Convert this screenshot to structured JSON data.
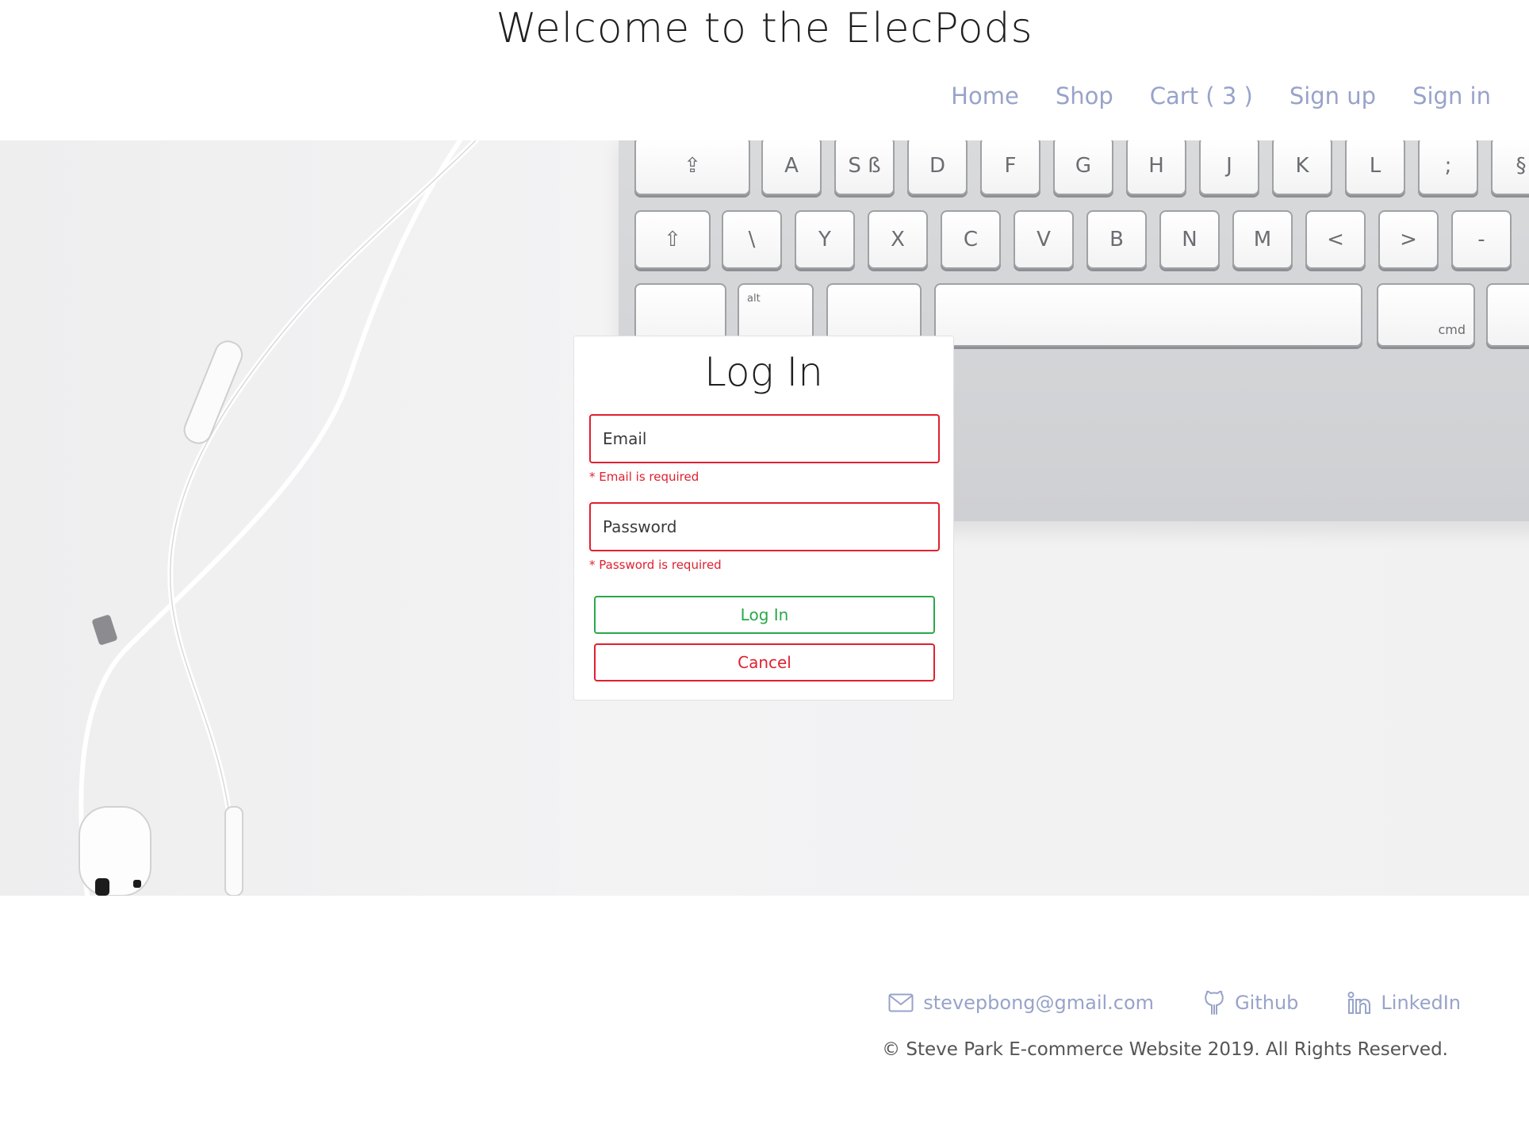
{
  "header": {
    "title": "Welcome to the ElecPods"
  },
  "nav": {
    "items": [
      {
        "label": "Home"
      },
      {
        "label": "Shop"
      },
      {
        "label": "Cart ( 3 )"
      },
      {
        "label": "Sign up"
      },
      {
        "label": "Sign in"
      }
    ]
  },
  "hero": {
    "keys_row1": [
      "A",
      "S ß",
      "D",
      "F",
      "G",
      "H",
      "J",
      "K",
      "L"
    ],
    "keys_row2": [
      "Y",
      "X",
      "C",
      "V",
      "B",
      "N",
      "M"
    ],
    "key_alt": "alt",
    "key_cmd": "cmd"
  },
  "login": {
    "title": "Log In",
    "email_placeholder": "Email",
    "email_error": "* Email is required",
    "password_placeholder": "Password",
    "password_error": "* Password is required",
    "submit_label": "Log In",
    "cancel_label": "Cancel"
  },
  "footer": {
    "email": "stevepbong@gmail.com",
    "github": "Github",
    "linkedin": "LinkedIn",
    "copyright": "© Steve Park E-commerce Website 2019. All Rights Reserved."
  },
  "colors": {
    "nav_link": "#98a3c9",
    "error": "#e0202f",
    "success": "#2aa84a"
  }
}
